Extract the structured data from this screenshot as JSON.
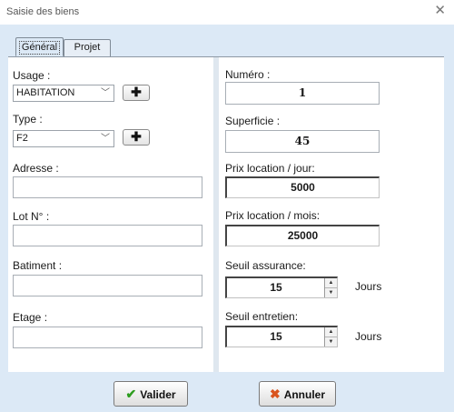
{
  "window": {
    "title": "Saisie des biens",
    "close_glyph": "✕"
  },
  "tabs": [
    {
      "label": "Général",
      "active": true
    },
    {
      "label": "Projet",
      "active": false
    }
  ],
  "left": {
    "usage": {
      "label": "Usage :",
      "value": "HABITATION",
      "add_glyph": "✚"
    },
    "type": {
      "label": "Type :",
      "value": "F2",
      "add_glyph": "✚"
    },
    "adresse": {
      "label": "Adresse :",
      "value": ""
    },
    "lot": {
      "label": "Lot N° :",
      "value": ""
    },
    "batiment": {
      "label": "Batiment :",
      "value": ""
    },
    "etage": {
      "label": "Etage :",
      "value": ""
    }
  },
  "right": {
    "numero": {
      "label": "Numéro :",
      "value": "1"
    },
    "superficie": {
      "label": "Superficie :",
      "value": "45"
    },
    "prix_jour": {
      "label": "Prix location / jour:",
      "value": "5000"
    },
    "prix_mois": {
      "label": "Prix location / mois:",
      "value": "25000"
    },
    "seuil_assurance": {
      "label": "Seuil assurance:",
      "value": "15",
      "unit": "Jours"
    },
    "seuil_entretien": {
      "label": "Seuil entretien:",
      "value": "15",
      "unit": "Jours"
    }
  },
  "icons": {
    "chevron": "﹀",
    "spin_up": "▲",
    "spin_down": "▼",
    "check": "✔",
    "cross": "✖"
  },
  "actions": {
    "valider_label": "Valider",
    "annuler_label": "Annuler"
  },
  "colors": {
    "client_bg": "#dce9f6",
    "check": "#2e9d1f",
    "cross": "#d9541e"
  }
}
